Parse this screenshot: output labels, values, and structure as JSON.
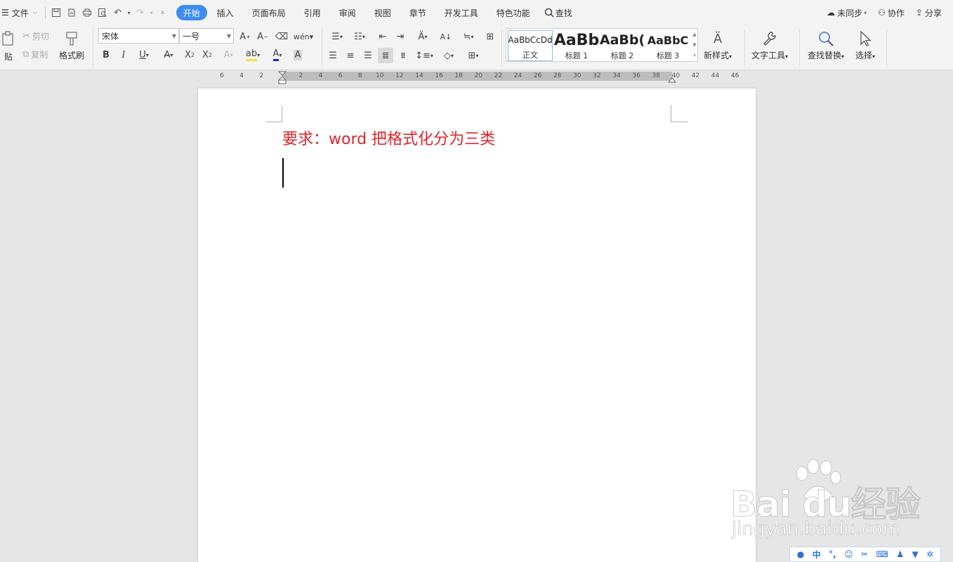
{
  "menubar": {
    "file_label": "文件",
    "tabs": [
      "开始",
      "插入",
      "页面布局",
      "引用",
      "审阅",
      "视图",
      "章节",
      "开发工具",
      "特色功能"
    ],
    "search_label": "查找",
    "sync_label": "未同步",
    "collab_label": "协作",
    "share_label": "分享"
  },
  "ribbon": {
    "paste_label": "贴",
    "cut_label": "剪切",
    "copy_label": "复制",
    "format_painter_label": "格式刷",
    "font_name": "宋体",
    "font_size": "一号",
    "styles": [
      {
        "preview": "AaBbCcDd",
        "name": "正文"
      },
      {
        "preview": "AaBb",
        "name": "标题 1"
      },
      {
        "preview": "AaBb(",
        "name": "标题 2"
      },
      {
        "preview": "AaBbC",
        "name": "标题 3"
      }
    ],
    "new_style_label": "新样式",
    "text_tools_label": "文字工具",
    "find_replace_label": "查找替换",
    "select_label": "选择"
  },
  "ruler": {
    "ticks": [
      "6",
      "4",
      "2",
      "",
      "2",
      "4",
      "6",
      "8",
      "10",
      "12",
      "14",
      "16",
      "18",
      "20",
      "22",
      "24",
      "26",
      "28",
      "30",
      "32",
      "34",
      "36",
      "38",
      "40",
      "42",
      "44",
      "46"
    ]
  },
  "document": {
    "title_text": "要求：word 把格式化分为三类",
    "title_color": "#e0242b"
  },
  "watermark": {
    "brand": "Bai du经验",
    "url": "jingyan.baidu.com"
  },
  "ime": {
    "lang": "中"
  },
  "colors": {
    "accent": "#3c8cf2"
  }
}
